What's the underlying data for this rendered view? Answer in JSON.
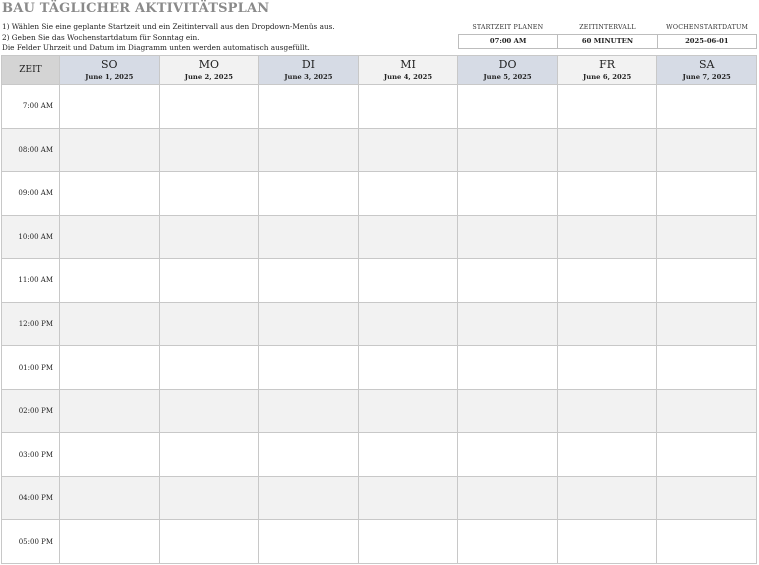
{
  "title": "BAU TÄGLICHER AKTIVITÄTSPLAN",
  "instructions": [
    "1) Wählen Sie eine geplante Startzeit und ein Zeitintervall aus den Dropdown-Menüs aus.",
    "2) Geben Sie das Wochenstartdatum für Sonntag ein.",
    "Die Felder Uhrzeit und Datum im Diagramm unten werden automatisch ausgefüllt."
  ],
  "params": {
    "start_label": "STARTZEIT PLANEN",
    "start_value": "07:00 AM",
    "interval_label": "ZEITINTERVALL",
    "interval_value": "60 MINUTEN",
    "week_label": "WOCHENSTARTDATUM",
    "week_value": "2025-06-01"
  },
  "schedule": {
    "time_header": "ZEIT",
    "days": [
      {
        "name": "SO",
        "date": "June 1, 2025"
      },
      {
        "name": "MO",
        "date": "June 2, 2025"
      },
      {
        "name": "DI",
        "date": "June 3, 2025"
      },
      {
        "name": "MI",
        "date": "June 4, 2025"
      },
      {
        "name": "DO",
        "date": "June 5, 2025"
      },
      {
        "name": "FR",
        "date": "June 6, 2025"
      },
      {
        "name": "SA",
        "date": "June 7, 2025"
      }
    ],
    "times": [
      "7:00 AM",
      "08:00 AM",
      "09:00 AM",
      "10:00 AM",
      "11:00 AM",
      "12:00 PM",
      "01:00 PM",
      "02:00 PM",
      "03:00 PM",
      "04:00 PM",
      "05:00 PM"
    ]
  },
  "colors": {
    "title": "#8a8a8a",
    "header_alt": "#d6dbe5",
    "header_plain": "#f2f2f2",
    "time_header": "#d4d4d4",
    "row_shade": "#f2f2f2"
  }
}
